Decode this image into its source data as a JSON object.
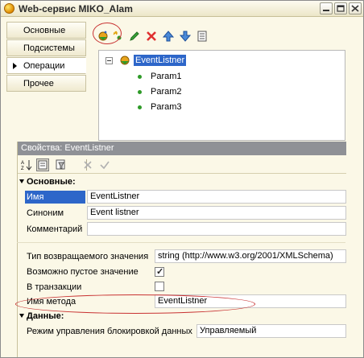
{
  "window": {
    "title": "Web-сервис MIKO_Alam"
  },
  "tabs": [
    {
      "label": "Основные",
      "active": false
    },
    {
      "label": "Подсистемы",
      "active": false
    },
    {
      "label": "Операции",
      "active": true
    },
    {
      "label": "Прочее",
      "active": false
    }
  ],
  "toolbar": {
    "icons": [
      "add-operation-icon",
      "add-parameter-icon",
      "edit-icon",
      "delete-icon",
      "move-up-icon",
      "move-down-icon",
      "list-icon"
    ]
  },
  "tree": {
    "root": "EventListner",
    "children": [
      "Param1",
      "Param2",
      "Param3"
    ]
  },
  "properties": {
    "header": "Свойства: EventListner",
    "sections": {
      "basic": "Основные:",
      "data": "Данные:"
    },
    "rows": {
      "name_label": "Имя",
      "name_value": "EventListner",
      "synonym_label": "Синоним",
      "synonym_value": "Event listner",
      "comment_label": "Комментарий",
      "comment_value": "",
      "return_type_label": "Тип возвращаемого значения",
      "return_type_value": "string (http://www.w3.org/2001/XMLSchema)",
      "nullable_label": "Возможно пустое значение",
      "nullable_checked": true,
      "transaction_label": "В транзакции",
      "transaction_checked": false,
      "method_name_label": "Имя метода",
      "method_name_value": "EventListner",
      "lock_mode_label": "Режим управления блокировкой данных",
      "lock_mode_value": "Управляемый"
    }
  },
  "colors": {
    "selection": "#2d66c9",
    "highlight_circle": "#c83232",
    "window_bg": "#fbf8e7",
    "props_header_bg": "#8f9196"
  }
}
